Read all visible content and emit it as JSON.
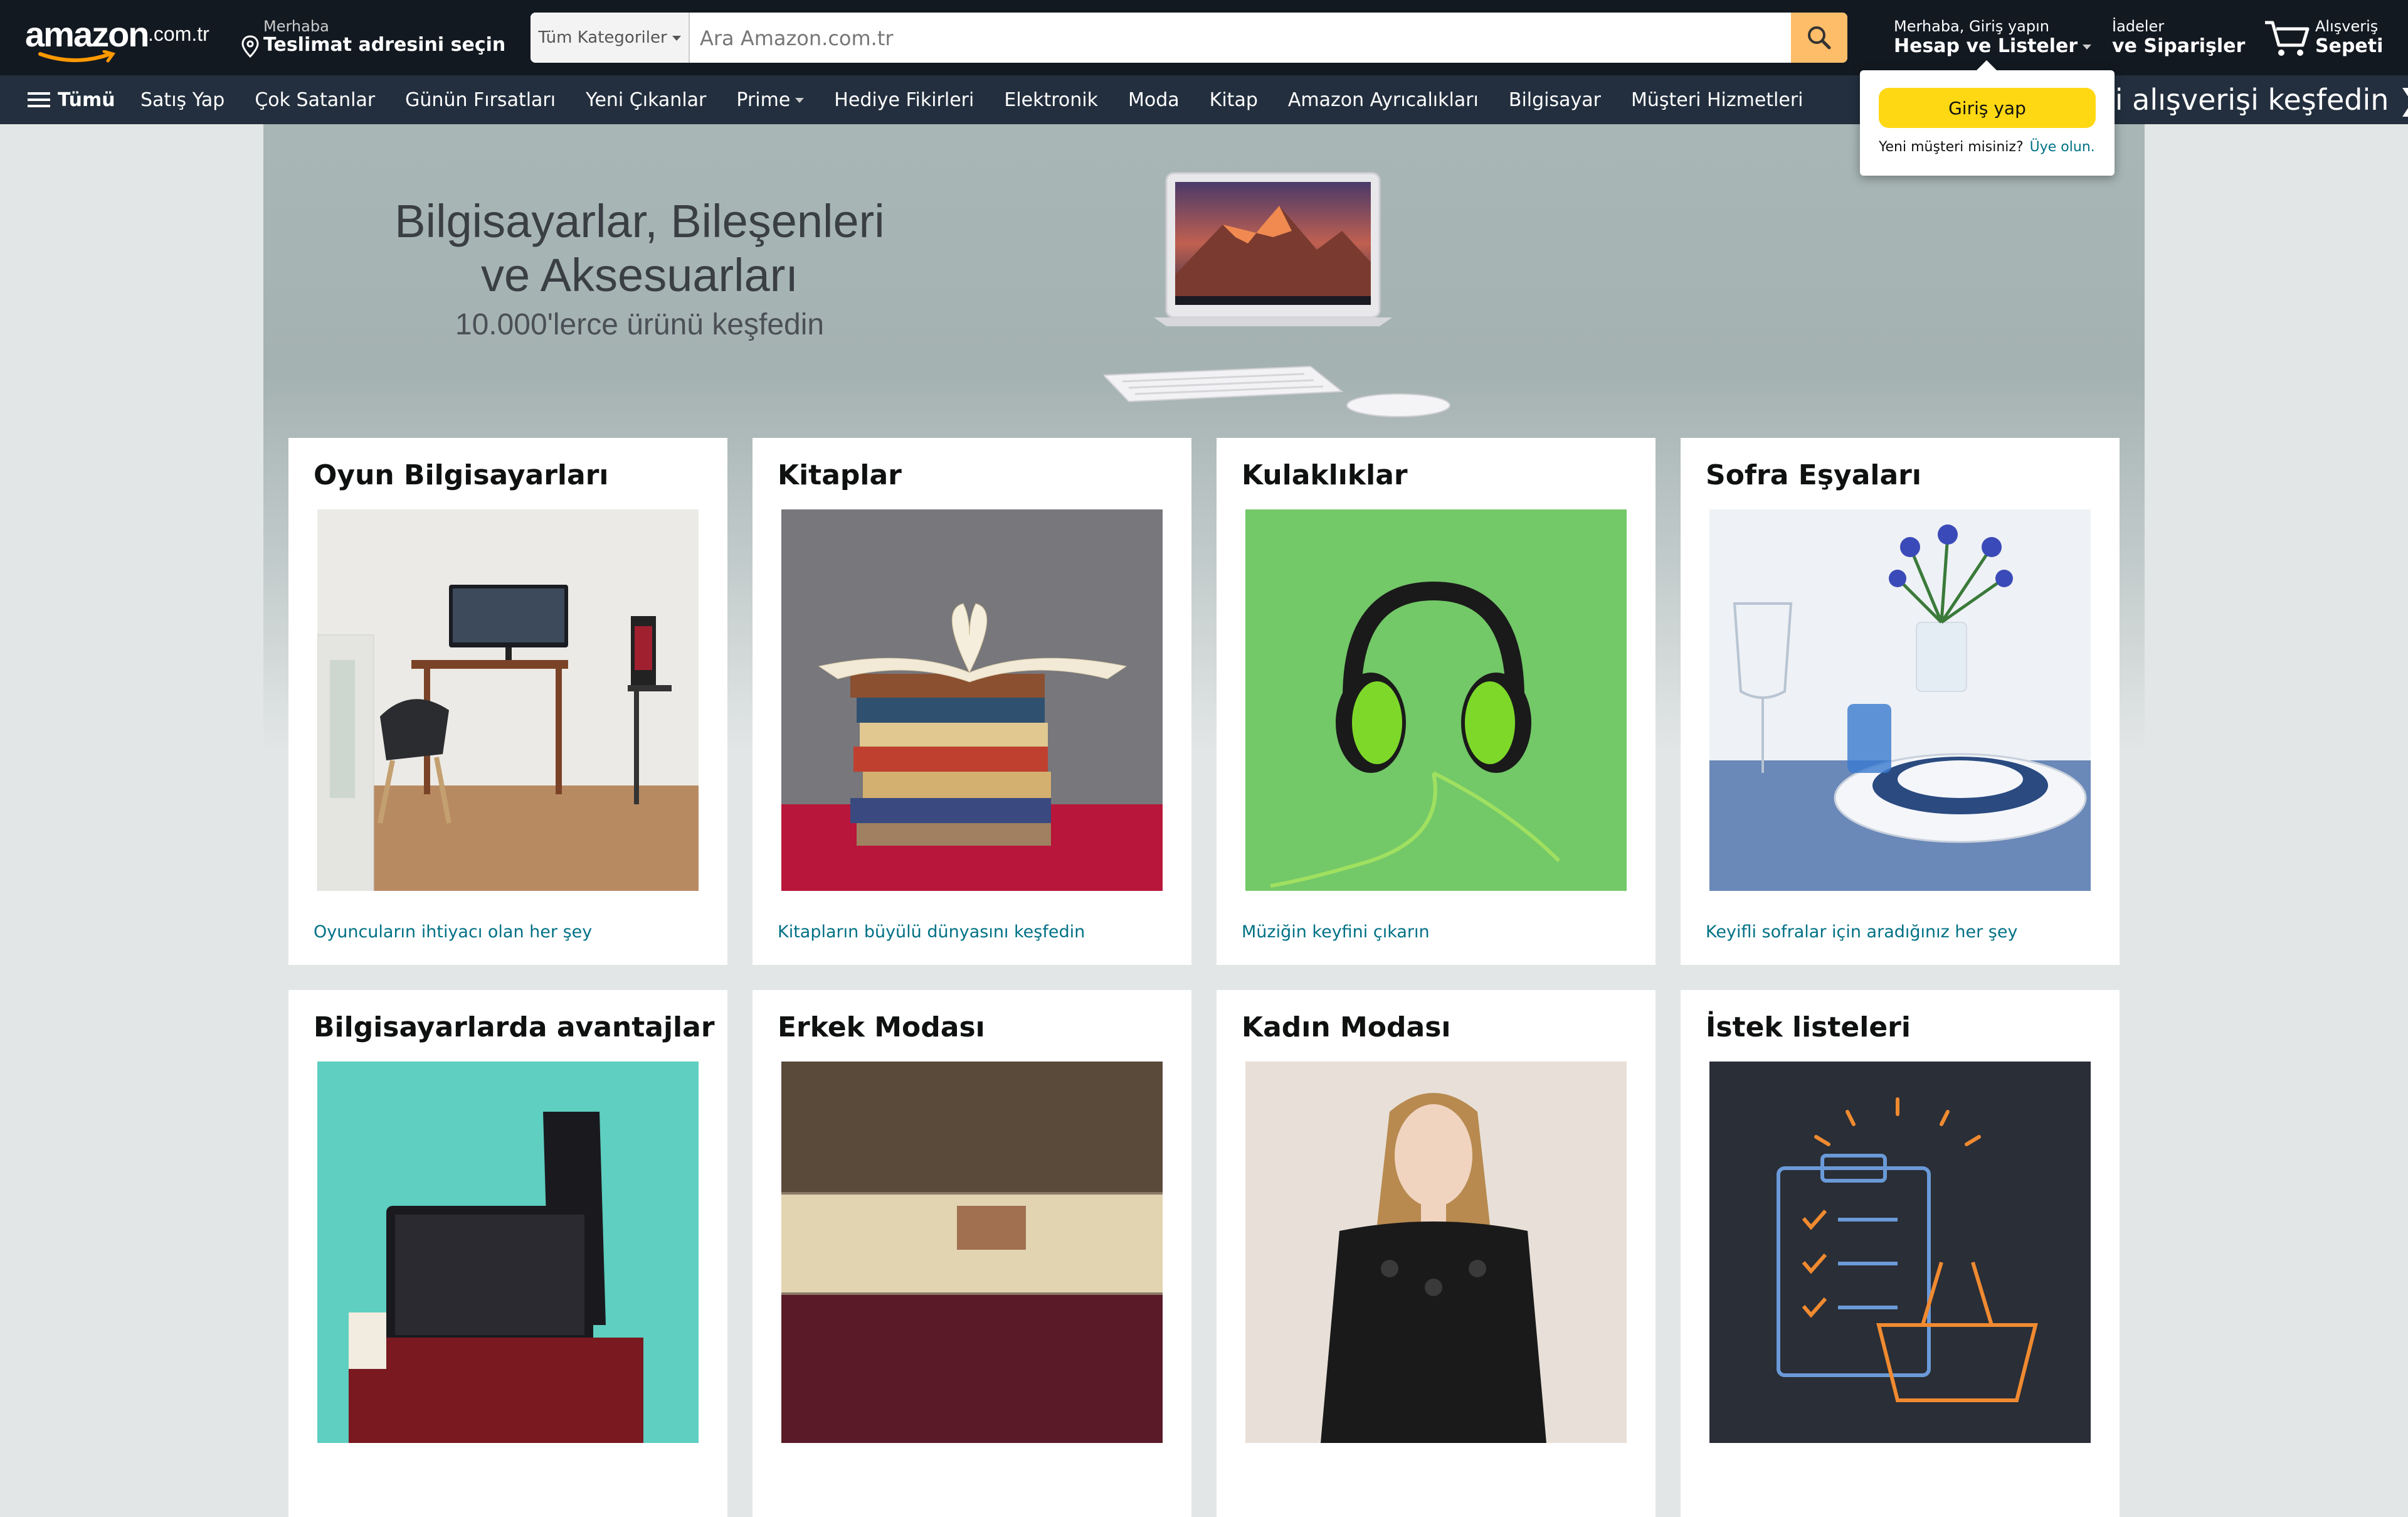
{
  "header": {
    "logo_text": "amazon",
    "logo_tld": ".com.tr",
    "deliver_line1": "Merhaba",
    "deliver_line2": "Teslimat adresini seçin",
    "search_category": "Tüm Kategoriler",
    "search_placeholder": "Ara Amazon.com.tr",
    "account_line1": "Merhaba, Giriş yapın",
    "account_line2": "Hesap ve Listeler",
    "returns_line1": "İadeler",
    "returns_line2": "ve Siparişler",
    "cart_line1": "Alışveriş",
    "cart_line2": "Sepeti",
    "cart_count": ""
  },
  "subnav": {
    "all_label": "Tümü",
    "links": [
      "Satış Yap",
      "Çok Satanlar",
      "Günün Fırsatları",
      "Yeni Çıkanlar",
      "Prime",
      "Hediye Fikirleri",
      "Elektronik",
      "Moda",
      "Kitap",
      "Amazon Ayrıcalıkları",
      "Bilgisayar",
      "Müşteri Hizmetleri"
    ],
    "promo": "li alışverişi keşfedin ❯"
  },
  "signin_popover": {
    "button": "Giriş yap",
    "new_customer": "Yeni müşteri misiniz?",
    "join_link": "Üye olun."
  },
  "hero": {
    "title_line1": "Bilgisayarlar, Bileşenleri",
    "title_line2": "ve Aksesuarları",
    "subtitle": "10.000'lerce ürünü keşfedin"
  },
  "cards": [
    {
      "title": "Oyun Bilgisayarları",
      "link": "Oyuncuların ihtiyacı olan her şey"
    },
    {
      "title": "Kitaplar",
      "link": "Kitapların büyülü dünyasını keşfedin"
    },
    {
      "title": "Kulaklıklar",
      "link": "Müziğin keyfini çıkarın"
    },
    {
      "title": "Sofra Eşyaları",
      "link": "Keyifli sofralar için aradığınız her şey"
    },
    {
      "title": "Bilgisayarlarda avantajlar",
      "link": ""
    },
    {
      "title": "Erkek Modası",
      "link": ""
    },
    {
      "title": "Kadın Modası",
      "link": ""
    },
    {
      "title": "İstek listeleri",
      "link": ""
    }
  ],
  "colors": {
    "nav_top": "#131921",
    "nav_sub": "#232f3e",
    "search_button": "#febd69",
    "signin_button": "#ffd814",
    "link": "#007185",
    "page_bg": "#e3e6e6"
  }
}
